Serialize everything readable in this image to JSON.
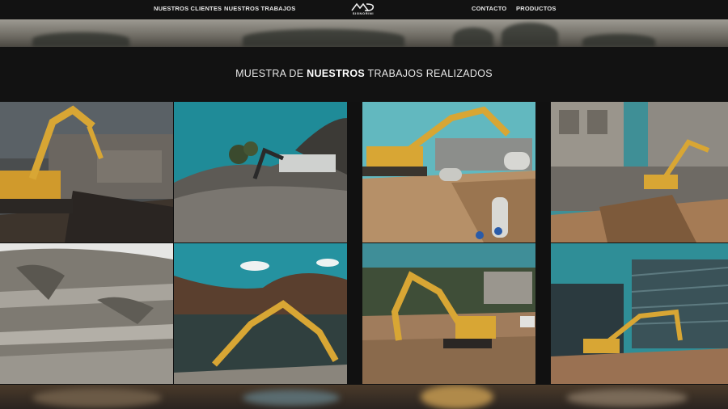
{
  "nav": {
    "left_items": [
      {
        "label": "NUESTROS CLIENTES"
      },
      {
        "label": "NUESTROS TRABAJOS"
      }
    ],
    "right_items": [
      {
        "label": "CONTACTO"
      },
      {
        "label": "PRODUCTOS"
      }
    ],
    "logo_text": "SIGNORINI"
  },
  "section": {
    "title_prefix": "MUESTRA DE ",
    "title_bold": "NUESTROS",
    "title_suffix": " TRABAJOS REALIZADOS"
  },
  "gallery": {
    "items": [
      {
        "subject": "excavator demolishing building"
      },
      {
        "subject": "excavator on rocky hillside"
      },
      {
        "subject": "excavator with pipes in trench"
      },
      {
        "subject": "excavator in urban demolition pit"
      },
      {
        "subject": "rock quarry terraces"
      },
      {
        "subject": "excavator by lake with mountains"
      },
      {
        "subject": "excavator digging in park"
      },
      {
        "subject": "excavator near glass buildings"
      }
    ]
  },
  "colors": {
    "nav_bg": "#121212",
    "band_bg": "#121212",
    "excavator_yellow": "#d8a634",
    "sky_teal": "#2b8f97"
  }
}
